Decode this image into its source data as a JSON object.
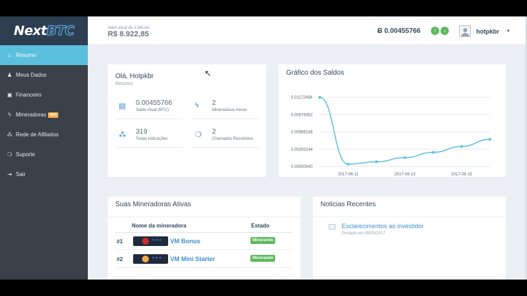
{
  "brand": {
    "part1": "Next",
    "part2": "BTC"
  },
  "sidebar": {
    "items": [
      {
        "label": "Resumo",
        "icon": "⌂"
      },
      {
        "label": "Meus Dados",
        "icon": "♟"
      },
      {
        "label": "Financeiro",
        "icon": "▣"
      },
      {
        "label": "Mineradoras",
        "icon": "ϟ",
        "badge": "HOT"
      },
      {
        "label": "Rede de Afiliados",
        "icon": "⁂"
      },
      {
        "label": "Suporte",
        "icon": "❍"
      },
      {
        "label": "Sair",
        "icon": "⇥"
      }
    ]
  },
  "topbar": {
    "price_label": "Valor atual de 1 bitcoin",
    "price_value": "R$ 8.922,85",
    "balance": "Ƀ 0.00455766",
    "username": "hotpkbr",
    "up_icon": "↑",
    "down_icon": "↓",
    "caret": "▾"
  },
  "welcome": {
    "hello": "Olá, Hotpkbr",
    "sub": "Resumo",
    "stats": [
      {
        "value": "0.00455766",
        "label": "Saldo Atual (BTC)",
        "icon": "▤"
      },
      {
        "value": "2",
        "label": "Mineradoras Ativas",
        "icon": "ϟ"
      },
      {
        "value": "319",
        "label": "Todas Indicações",
        "icon": "⁂"
      },
      {
        "value": "2",
        "label": "Chamados Resolvidos",
        "icon": "❍"
      }
    ]
  },
  "chart_panel": {
    "title": "Gráfico dos Saldos"
  },
  "chart_data": {
    "type": "line",
    "title": "Gráfico dos Saldos",
    "y_ticks": [
      "0.01172456",
      "0.00879352",
      "0.00586248",
      "0.00293144",
      "0.00000040"
    ],
    "x_ticks": [
      "2017-06-11",
      "2017-06-13",
      "2017-06-15"
    ],
    "ylim": [
      4e-07,
      0.01172456
    ],
    "x": [
      "2017-06-10",
      "2017-06-11",
      "2017-06-12",
      "2017-06-13",
      "2017-06-14",
      "2017-06-15",
      "2017-06-16"
    ],
    "values": [
      0.01172456,
      0.0004,
      0.0008,
      0.0015,
      0.0024,
      0.0034,
      0.0046
    ],
    "color": "#5bc0de"
  },
  "miners": {
    "title": "Suas Mineradoras Ativas",
    "col_name": "Nome da mineradora",
    "col_status": "Estado",
    "rows": [
      {
        "idx": "#1",
        "name": "VM Bonus",
        "status": "Minerando",
        "coin_color": "#c9302c"
      },
      {
        "idx": "#2",
        "name": "VM Mini Starter",
        "status": "Minerando",
        "coin_color": "#f0ad4e"
      }
    ]
  },
  "news": {
    "title": "Noticias Recentes",
    "item_title": "Esclarecimentos ao investidor",
    "item_date": "Postado em 09/05/2017"
  }
}
